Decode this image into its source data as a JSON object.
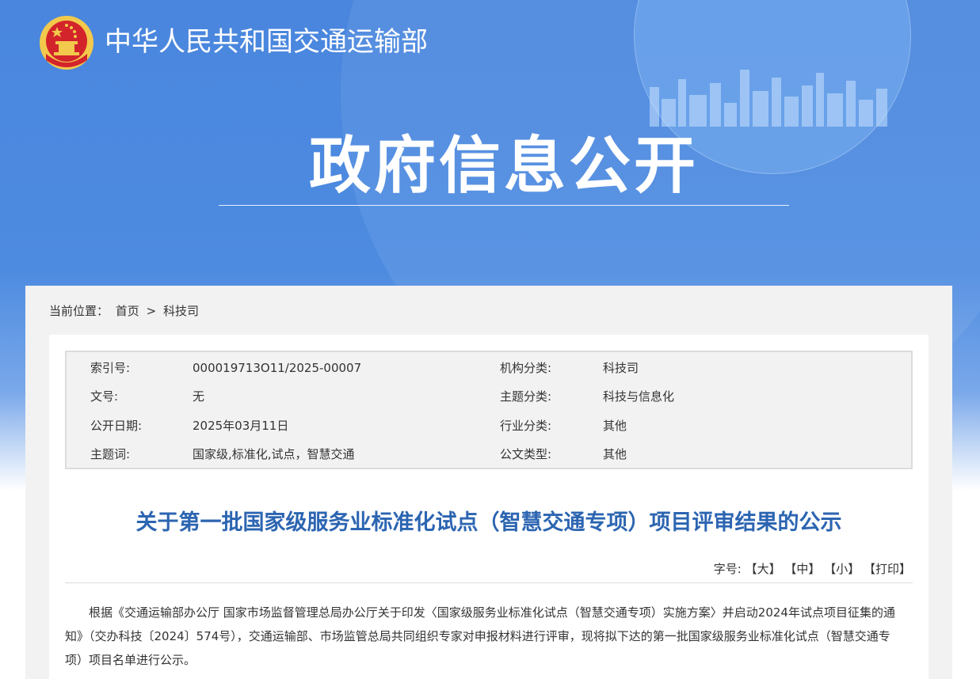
{
  "header": {
    "ministry_name": "中华人民共和国交通运输部",
    "hero_title": "政府信息公开"
  },
  "breadcrumb": {
    "label": "当前位置：",
    "home": "首页",
    "separator": ">",
    "current": "科技司"
  },
  "meta": {
    "rows": [
      {
        "k1": "索引号:",
        "v1": "000019713O11/2025-00007",
        "k2": "机构分类:",
        "v2": "科技司"
      },
      {
        "k1": "文号:",
        "v1": "无",
        "k2": "主题分类:",
        "v2": "科技与信息化"
      },
      {
        "k1": "公开日期:",
        "v1": "2025年03月11日",
        "k2": "行业分类:",
        "v2": "其他"
      },
      {
        "k1": "主题词:",
        "v1": "国家级,标准化,试点，智慧交通",
        "k2": "公文类型:",
        "v2": "其他"
      }
    ]
  },
  "article": {
    "title": "关于第一批国家级服务业标准化试点（智慧交通专项）项目评审结果的公示",
    "font_size_label": "字号:",
    "size_large": "【大】",
    "size_medium": "【中】",
    "size_small": "【小】",
    "print": "【打印】",
    "paragraph": "根据《交通运输部办公厅 国家市场监督管理总局办公厅关于印发〈国家级服务业标准化试点（智慧交通专项）实施方案〉并启动2024年试点项目征集的通知》（交办科技〔2024〕574号），交通运输部、市场监管总局共同组织专家对申报材料进行评审，现将拟下达的第一批国家级服务业标准化试点（智慧交通专项）项目名单进行公示。"
  },
  "colors": {
    "banner_blue": "#4a86de",
    "title_blue": "#2c65b1",
    "emblem_red": "#d3242b",
    "emblem_gold": "#f2c94c"
  }
}
